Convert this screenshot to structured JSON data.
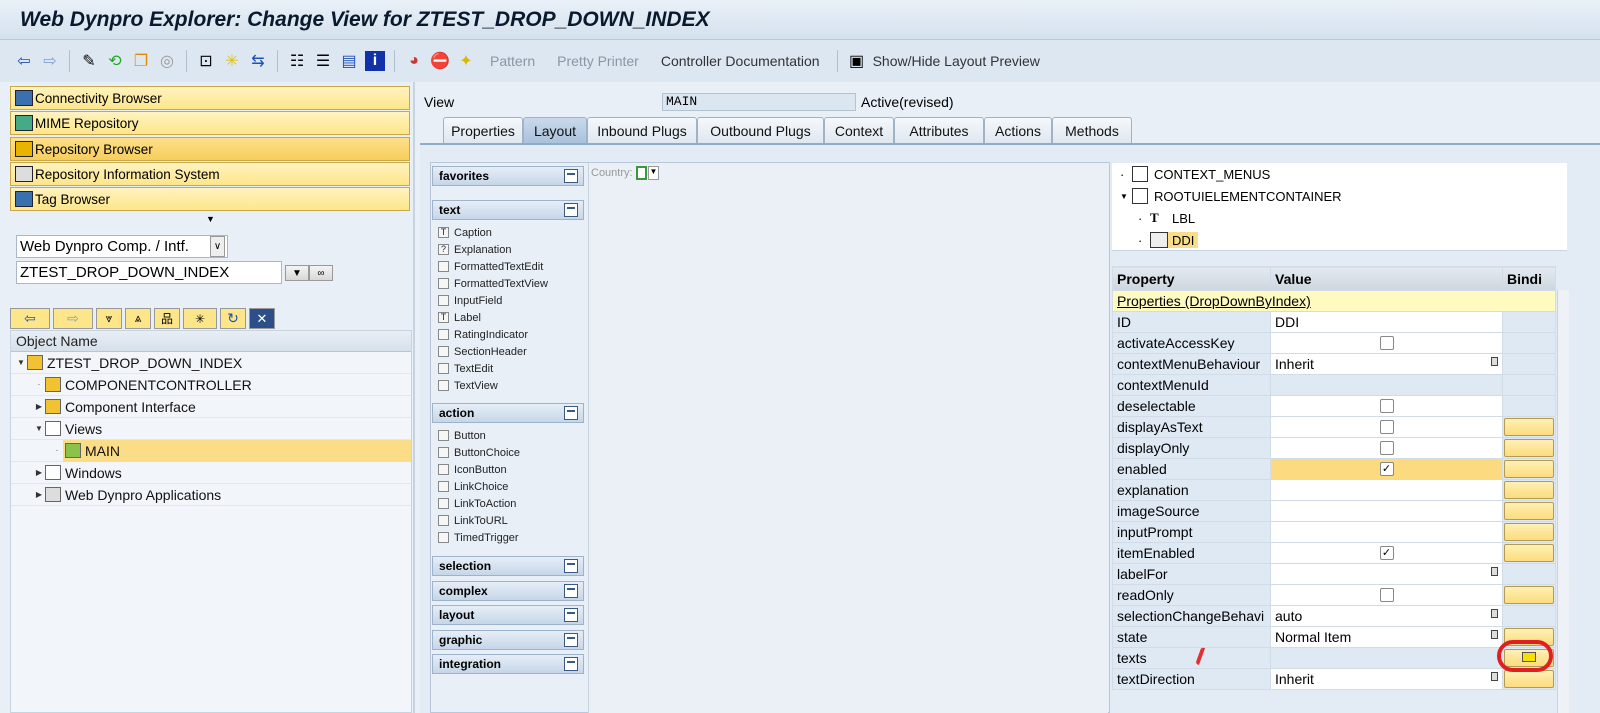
{
  "title": "Web Dynpro Explorer: Change View for ZTEST_DROP_DOWN_INDEX",
  "toolbar": {
    "pattern": "Pattern",
    "pretty_printer": "Pretty Printer",
    "controller_doc": "Controller Documentation",
    "layout_preview": "Show/Hide Layout Preview"
  },
  "left": {
    "nav_buttons": [
      "Connectivity Browser",
      "MIME Repository",
      "Repository Browser",
      "Repository Information System",
      "Tag Browser"
    ],
    "object_type": "Web Dynpro Comp. / Intf.",
    "object_name": "ZTEST_DROP_DOWN_INDEX",
    "tree_header": "Object Name",
    "tree": [
      {
        "label": "ZTEST_DROP_DOWN_INDEX"
      },
      {
        "label": "COMPONENTCONTROLLER"
      },
      {
        "label": "Component Interface"
      },
      {
        "label": "Views"
      },
      {
        "label": "MAIN"
      },
      {
        "label": "Windows"
      },
      {
        "label": "Web Dynpro Applications"
      }
    ]
  },
  "view": {
    "label": "View",
    "name": "MAIN",
    "status": "Active(revised)"
  },
  "tabs": [
    "Properties",
    "Layout",
    "Inbound Plugs",
    "Outbound Plugs",
    "Context",
    "Attributes",
    "Actions",
    "Methods"
  ],
  "palette": {
    "favorites": "favorites",
    "text": "text",
    "text_items": [
      "Caption",
      "Explanation",
      "FormattedTextEdit",
      "FormattedTextView",
      "InputField",
      "Label",
      "RatingIndicator",
      "SectionHeader",
      "TextEdit",
      "TextView"
    ],
    "action": "action",
    "action_items": [
      "Button",
      "ButtonChoice",
      "IconButton",
      "LinkChoice",
      "LinkToAction",
      "LinkToURL",
      "TimedTrigger"
    ],
    "groups": [
      "selection",
      "complex",
      "layout",
      "graphic",
      "integration"
    ]
  },
  "canvas": {
    "country_label": "Country:"
  },
  "ui_tree": [
    "CONTEXT_MENUS",
    "ROOTUIELEMENTCONTAINER",
    "LBL",
    "DDI"
  ],
  "props": {
    "headers": [
      "Property",
      "Value",
      "Bindi"
    ],
    "section": "Properties (DropDownByIndex)",
    "rows": [
      {
        "name": "ID",
        "value": "DDI"
      },
      {
        "name": "activateAccessKey",
        "value": ""
      },
      {
        "name": "contextMenuBehaviour",
        "value": "Inherit"
      },
      {
        "name": "contextMenuId",
        "value": ""
      },
      {
        "name": "deselectable",
        "value": ""
      },
      {
        "name": "displayAsText",
        "value": ""
      },
      {
        "name": "displayOnly",
        "value": ""
      },
      {
        "name": "enabled",
        "value": "✓"
      },
      {
        "name": "explanation",
        "value": ""
      },
      {
        "name": "imageSource",
        "value": ""
      },
      {
        "name": "inputPrompt",
        "value": ""
      },
      {
        "name": "itemEnabled",
        "value": "✓"
      },
      {
        "name": "labelFor",
        "value": ""
      },
      {
        "name": "readOnly",
        "value": ""
      },
      {
        "name": "selectionChangeBehavi",
        "value": "auto"
      },
      {
        "name": "state",
        "value": "Normal Item"
      },
      {
        "name": "texts",
        "value": ""
      },
      {
        "name": "textDirection",
        "value": "Inherit"
      }
    ]
  }
}
